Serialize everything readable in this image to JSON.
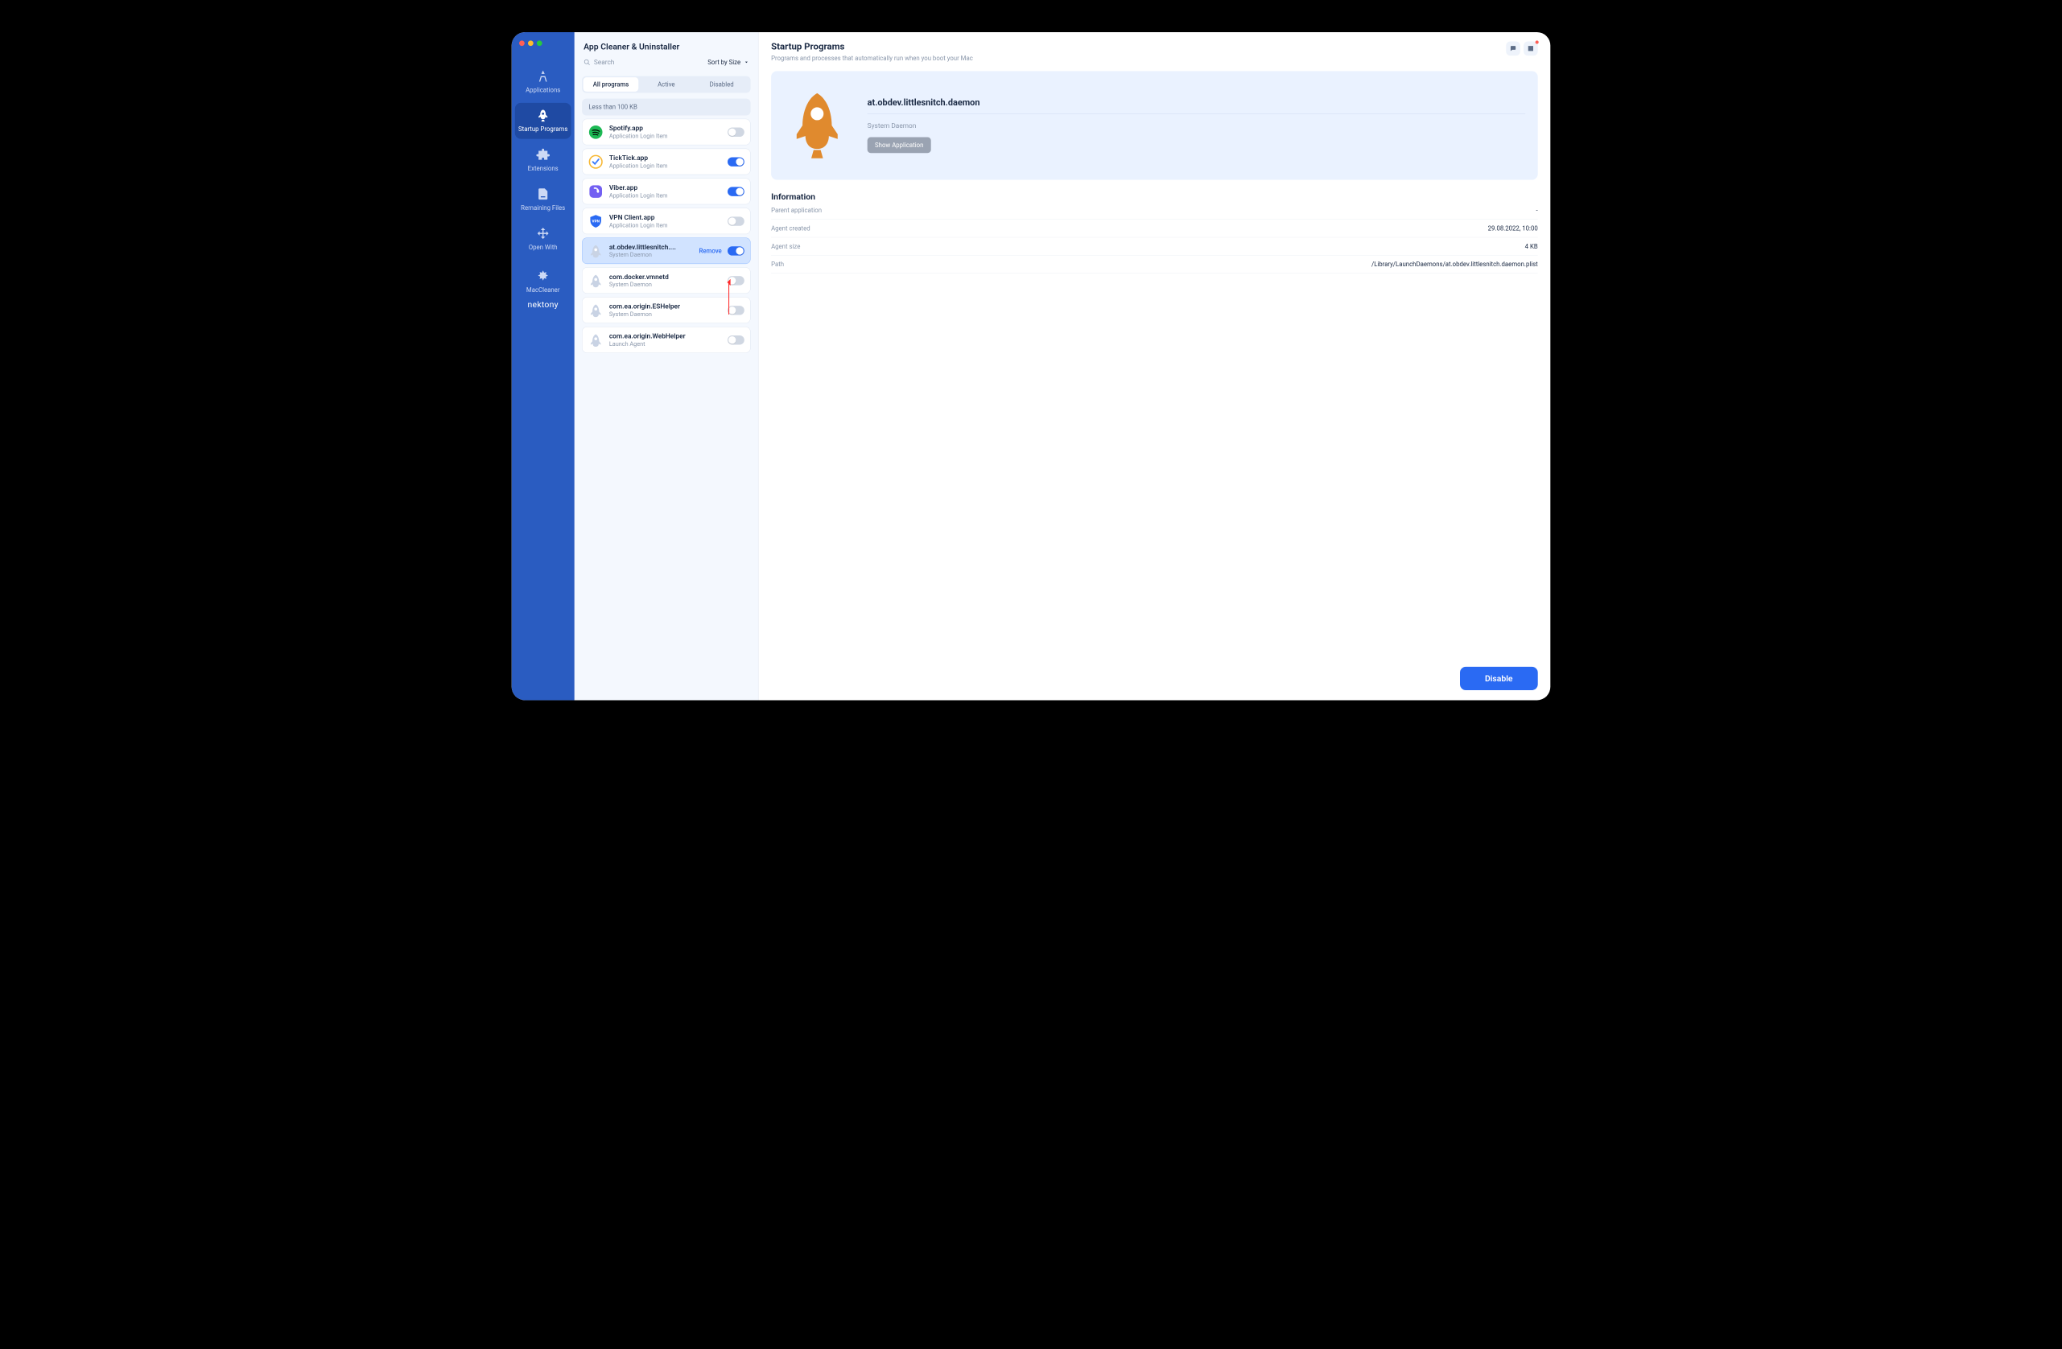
{
  "app_title": "App Cleaner & Uninstaller",
  "sidebar": {
    "items": [
      {
        "label": "Applications"
      },
      {
        "label": "Startup Programs"
      },
      {
        "label": "Extensions"
      },
      {
        "label": "Remaining Files"
      },
      {
        "label": "Open With"
      },
      {
        "label": "MacCleaner"
      }
    ],
    "brand": "nektony"
  },
  "search": {
    "placeholder": "Search"
  },
  "sort_label": "Sort by Size",
  "tabs": [
    {
      "label": "All programs"
    },
    {
      "label": "Active"
    },
    {
      "label": "Disabled"
    }
  ],
  "group_label": "Less than 100 KB",
  "list": [
    {
      "name": "Spotify.app",
      "sub": "Application Login Item",
      "on": false,
      "icon": "spotify"
    },
    {
      "name": "TickTick.app",
      "sub": "Application Login Item",
      "on": true,
      "icon": "ticktick"
    },
    {
      "name": "Viber.app",
      "sub": "Application Login Item",
      "on": true,
      "icon": "viber"
    },
    {
      "name": "VPN Client.app",
      "sub": "Application Login Item",
      "on": false,
      "icon": "vpn"
    },
    {
      "name": "at.obdev.littlesnitch....",
      "sub": "System Daemon",
      "on": true,
      "icon": "rocket",
      "selected": true,
      "remove": true
    },
    {
      "name": "com.docker.vmnetd",
      "sub": "System Daemon",
      "on": false,
      "icon": "rocket"
    },
    {
      "name": "com.ea.origin.ESHelper",
      "sub": "System Daemon",
      "on": false,
      "icon": "rocket"
    },
    {
      "name": "com.ea.origin.WebHelper",
      "sub": "Launch Agent",
      "on": false,
      "icon": "rocket"
    }
  ],
  "remove_label": "Remove",
  "detail": {
    "title": "Startup Programs",
    "subtitle": "Programs and processes that automatically run when you boot your Mac",
    "hero_name": "at.obdev.littlesnitch.daemon",
    "hero_type": "System Daemon",
    "show_btn": "Show Application",
    "info_title": "Information",
    "rows": [
      {
        "k": "Parent application",
        "v": "-"
      },
      {
        "k": "Agent created",
        "v": "29.08.2022, 10:00"
      },
      {
        "k": "Agent size",
        "v": "4 KB"
      },
      {
        "k": "Path",
        "v": "/Library/LaunchDaemons/at.obdev.littlesnitch.daemon.plist"
      }
    ],
    "disable_btn": "Disable"
  }
}
